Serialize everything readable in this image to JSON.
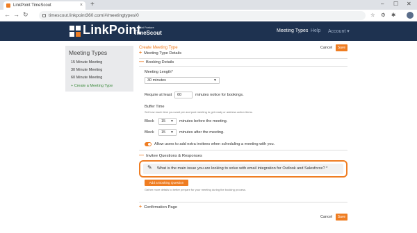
{
  "browser": {
    "tab_title": "LinkPoint TimeScout",
    "tab_close": "×",
    "new_tab": "+",
    "minimize": "–",
    "maximize": "☐",
    "close": "✕",
    "back": "←",
    "forward": "→",
    "reload": "↻",
    "url": "timescout.linkpoint360.com/#/meetingtypes/0",
    "star": "☆",
    "extensions": "⚙",
    "puzzle": "✱",
    "menu": "⋮"
  },
  "header": {
    "logo_text": "LinkPoint",
    "pilot_label": "Pilot Feature",
    "product_name": "TimeScout",
    "nav": {
      "meeting_types": "Meeting Types",
      "help": "Help",
      "account": "Account ▾"
    }
  },
  "sidebar": {
    "title": "Meeting Types",
    "items": [
      {
        "label": "15 Minute Meeting"
      },
      {
        "label": "30 Minute Meeting"
      },
      {
        "label": "60 Minute Meeting"
      },
      {
        "label": "+ Create a Meeting Type"
      }
    ]
  },
  "main": {
    "title": "Create Meeting Type",
    "cancel_label": "Cancel",
    "save_label": "Save",
    "sections": {
      "meeting_type_details": "Meeting Type Details",
      "booking_details": "Booking Details",
      "invitee_questions": "Invitee Questions & Responses",
      "confirmation_page": "Confirmation Page"
    },
    "plus_sign": "+",
    "minus_sign": "—",
    "booking": {
      "meeting_length_label": "Meeting Length*",
      "meeting_length_value": "30 minutes",
      "require_prefix": "Require at least",
      "require_value": "60",
      "require_suffix": "minutes notice for bookings.",
      "buffer_title": "Buffer Time",
      "buffer_desc": "Set how much time you want pre and post meeting to get ready or address action items.",
      "block_label": "Block",
      "before_value": "15",
      "before_suffix": "minutes before the meeting.",
      "after_value": "15",
      "after_suffix": "minutes after the meeting.",
      "allow_invitees_label": "Allow users to add extra invitees when scheduling a meeting with you."
    },
    "question": {
      "text": "What is the main issue you are looking to solve with email integration for Outlook and Salesforce? *",
      "add_label": "Add a Booking Question",
      "add_help": "Gather more details to better prepare for your meeting during the booking process."
    },
    "bottom_cancel_label": "Cancel",
    "bottom_save_label": "Save"
  }
}
